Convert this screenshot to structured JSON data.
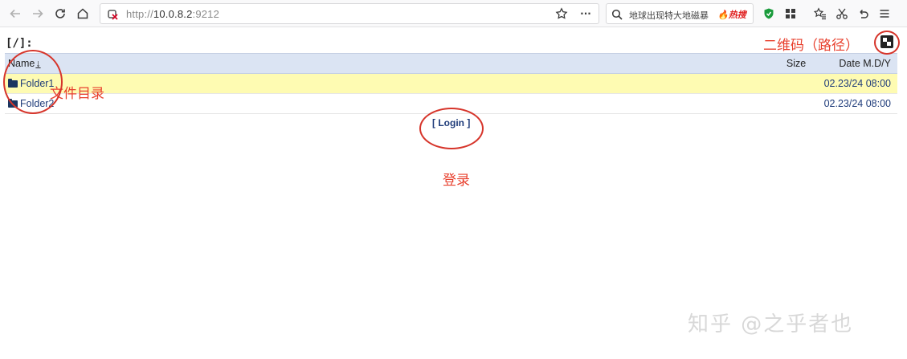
{
  "browser": {
    "url_scheme": "http://",
    "url_host": "10.0.8.2",
    "url_port": ":9212",
    "search_text": "地球出现特大地磁暴",
    "hot_label": "热搜",
    "more_label": "···"
  },
  "page": {
    "path": "[/]:",
    "login_label": "[ Login ]"
  },
  "table": {
    "headers": {
      "name": "Name",
      "sort_arrow": "↓",
      "size": "Size",
      "date": "Date M.D/Y"
    },
    "rows": [
      {
        "name": "Folder1",
        "size": "",
        "date": "02.23/24 08:00"
      },
      {
        "name": "Folder2",
        "size": "",
        "date": "02.23/24 08:00"
      }
    ]
  },
  "annotations": {
    "qr_label": "二维码（路径）",
    "dir_label": "文件目录",
    "login_label": "登录",
    "color": "#e8402e"
  },
  "watermark": "知乎 @之乎者也",
  "colors": {
    "header_bg": "#dbe4f3",
    "highlight_row": "#fefbb2",
    "link": "#1f3c7a"
  }
}
